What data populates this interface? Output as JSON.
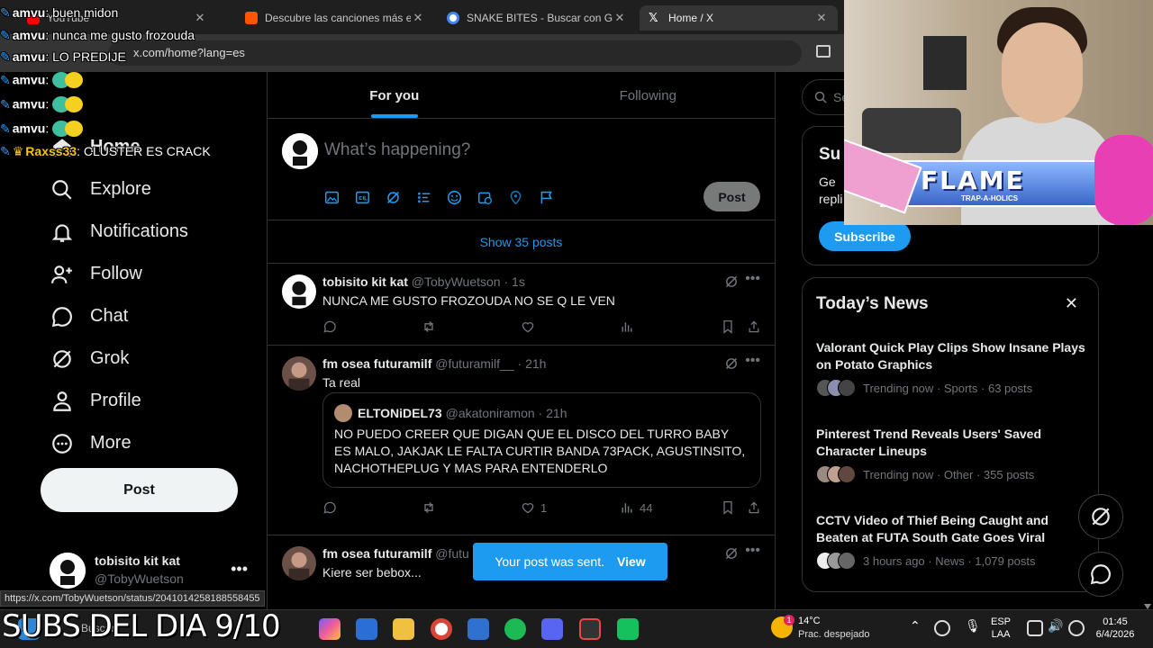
{
  "browser": {
    "tabs": [
      {
        "label": "YouTube",
        "icon": "youtube-icon",
        "color": "#ff0000"
      },
      {
        "label": "Descubre las canciones más escuchadas",
        "icon": "soundcloud-icon",
        "color": "#ff5500"
      },
      {
        "label": "SNAKE BITES - Buscar con Google",
        "icon": "google-icon",
        "color": "#4285f4"
      },
      {
        "label": "Home / X",
        "icon": "x-logo-icon",
        "color": "#ffffff"
      }
    ],
    "url": "x.com/home?lang=es"
  },
  "nav": {
    "items": [
      {
        "label": "Home",
        "icon": "home-icon"
      },
      {
        "label": "Explore",
        "icon": "search-icon"
      },
      {
        "label": "Notifications",
        "icon": "bell-icon"
      },
      {
        "label": "Follow",
        "icon": "person-add-icon"
      },
      {
        "label": "Chat",
        "icon": "chat-icon"
      },
      {
        "label": "Grok",
        "icon": "grok-icon"
      },
      {
        "label": "Profile",
        "icon": "person-icon"
      },
      {
        "label": "More",
        "icon": "more-circle-icon"
      }
    ],
    "post_label": "Post",
    "account": {
      "name": "tobisito kit kat",
      "handle": "@TobyWuetson"
    }
  },
  "feed": {
    "tabs": [
      "For you",
      "Following"
    ],
    "composer": {
      "placeholder": "What’s happening?",
      "post_label": "Post"
    },
    "show_posts": "Show 35 posts",
    "tweets": [
      {
        "name": "tobisito kit kat",
        "handle": "@TobyWuetson",
        "time": "1s",
        "text": "NUNCA ME GUSTO FROZOUDA NO SE Q LE VEN",
        "likes": "",
        "views": ""
      },
      {
        "name": "fm osea futuramilf",
        "handle": "@futuramilf__",
        "time": "21h",
        "text": "Ta real",
        "quote": {
          "name": "ELTONiDEL73",
          "handle": "@akatoniramon",
          "time": "21h",
          "text": "NO PUEDO CREER QUE DIGAN QUE EL DISCO DEL TURRO BABY ES MALO, JAKJAK LE FALTA CURTIR BANDA 73PACK, AGUSTINSITO, NACHOTHEPLUG Y MAS PARA ENTENDERLO"
        },
        "likes": "1",
        "views": "44"
      },
      {
        "name": "fm osea futuramilf",
        "handle": "@futu",
        "text": "Kiere ser bebox..."
      }
    ],
    "toast": {
      "text": "Your post was sent.",
      "action": "View"
    }
  },
  "right": {
    "search_placeholder": "Se",
    "subscribe": {
      "title": "Su",
      "desc_line1": "Ge",
      "desc_line2": "repli",
      "button": "Subscribe"
    },
    "news": {
      "title": "Today’s News",
      "items": [
        {
          "headline": "Valorant Quick Play Clips Show Insane Plays on Potato Graphics",
          "meta": "Trending now · Sports · 63 posts"
        },
        {
          "headline": "Pinterest Trend Reveals Users' Saved Character Lineups",
          "meta": "Trending now · Other · 355 posts"
        },
        {
          "headline": "CCTV Video of Thief Being Caught and Beaten at FUTA South Gate Goes Viral",
          "meta": "3 hours ago · News · 1,079 posts"
        }
      ]
    }
  },
  "status_url": "https://x.com/TobyWuetson/status/2041014258188558455",
  "overlay": {
    "subs": "SUBS DEL DIA 9/10",
    "chat": [
      {
        "user": "amvu",
        "msg": "buen midon",
        "crown": false,
        "emote": false
      },
      {
        "user": "amvu",
        "msg": "nunca me gusto frozouda",
        "crown": false,
        "emote": false
      },
      {
        "user": "amvu",
        "msg": "LO PREDIJE",
        "crown": false,
        "emote": false
      },
      {
        "user": "amvu",
        "msg": "",
        "crown": false,
        "emote": true
      },
      {
        "user": "amvu",
        "msg": "",
        "crown": false,
        "emote": true
      },
      {
        "user": "amvu",
        "msg": "",
        "crown": false,
        "emote": true
      },
      {
        "user": "Raxss33",
        "msg": "CLUSTER ES CRACK",
        "crown": true,
        "emote": false
      }
    ],
    "cam_banner": "FLAME",
    "cam_banner_sub": "TRAP-A-HOLICS"
  },
  "taskbar": {
    "search_text": "Buscar",
    "weather": {
      "temp": "14°C",
      "condition": "Prac. despejado",
      "badge": "1"
    },
    "lang": [
      "ESP",
      "LAA"
    ],
    "time": "01:45",
    "date": "6/4/2026"
  },
  "colors": {
    "accent": "#1d9bf0",
    "bg": "#000000",
    "border": "#2f3336",
    "muted": "#71767b"
  }
}
